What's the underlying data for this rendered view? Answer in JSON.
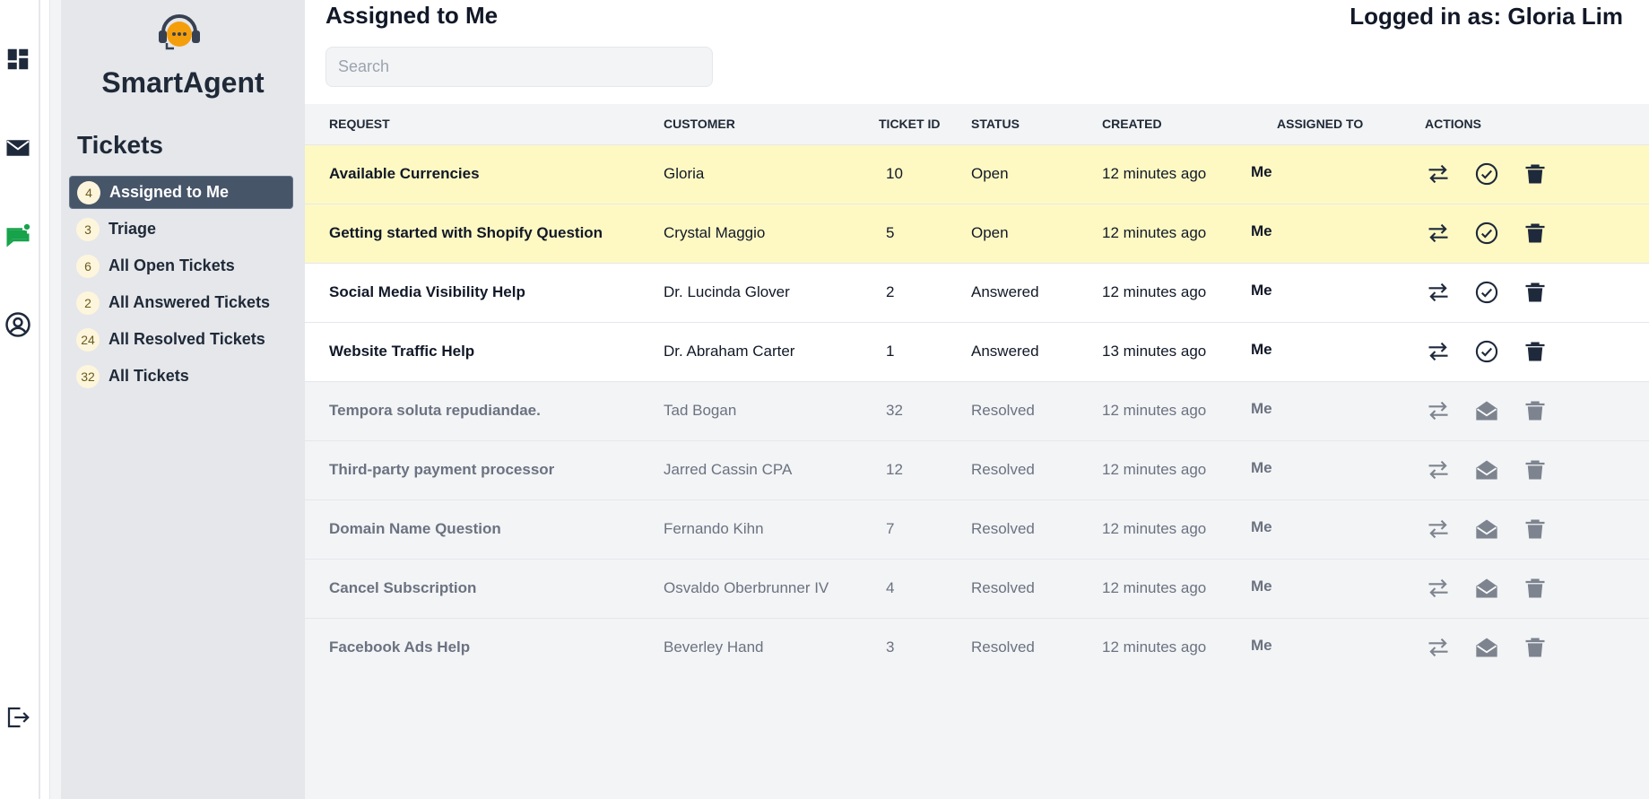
{
  "app": {
    "brand": "SmartAgent"
  },
  "rail": {
    "icons": [
      "dashboard-icon",
      "mail-icon",
      "chat-notification-icon",
      "user-circle-icon",
      "logout-icon"
    ],
    "accent": "#16a34a"
  },
  "sidebar": {
    "section_title": "Tickets",
    "items": [
      {
        "count": "4",
        "label": "Assigned to Me",
        "active": true
      },
      {
        "count": "3",
        "label": "Triage"
      },
      {
        "count": "6",
        "label": "All Open Tickets"
      },
      {
        "count": "2",
        "label": "All Answered Tickets"
      },
      {
        "count": "24",
        "label": "All Resolved Tickets"
      },
      {
        "count": "32",
        "label": "All Tickets"
      }
    ]
  },
  "header": {
    "title": "Assigned to Me",
    "logged_in": "Logged in as: Gloria Lim",
    "search_placeholder": "Search"
  },
  "table": {
    "columns": {
      "request": "Request",
      "customer": "Customer",
      "ticket_id": "Ticket ID",
      "status": "Status",
      "created": "Created",
      "assigned_to": "Assigned To",
      "actions": "Actions"
    },
    "rows": [
      {
        "request": "Available Currencies",
        "customer": "Gloria",
        "id": "10",
        "status": "Open",
        "created": "12 minutes ago",
        "assigned": "Me"
      },
      {
        "request": "Getting started with Shopify Question",
        "customer": "Crystal Maggio",
        "id": "5",
        "status": "Open",
        "created": "12 minutes ago",
        "assigned": "Me"
      },
      {
        "request": "Social Media Visibility Help",
        "customer": "Dr. Lucinda Glover",
        "id": "2",
        "status": "Answered",
        "created": "12 minutes ago",
        "assigned": "Me"
      },
      {
        "request": "Website Traffic Help",
        "customer": "Dr. Abraham Carter",
        "id": "1",
        "status": "Answered",
        "created": "13 minutes ago",
        "assigned": "Me"
      },
      {
        "request": "Tempora soluta repudiandae.",
        "customer": "Tad Bogan",
        "id": "32",
        "status": "Resolved",
        "created": "12 minutes ago",
        "assigned": "Me"
      },
      {
        "request": "Third-party payment processor",
        "customer": "Jarred Cassin CPA",
        "id": "12",
        "status": "Resolved",
        "created": "12 minutes ago",
        "assigned": "Me"
      },
      {
        "request": "Domain Name Question",
        "customer": "Fernando Kihn",
        "id": "7",
        "status": "Resolved",
        "created": "12 minutes ago",
        "assigned": "Me"
      },
      {
        "request": "Cancel Subscription",
        "customer": "Osvaldo Oberbrunner IV",
        "id": "4",
        "status": "Resolved",
        "created": "12 minutes ago",
        "assigned": "Me"
      },
      {
        "request": "Facebook Ads Help",
        "customer": "Beverley Hand",
        "id": "3",
        "status": "Resolved",
        "created": "12 minutes ago",
        "assigned": "Me"
      }
    ]
  },
  "colors": {
    "open_row": "#fef9c3",
    "active_nav": "#475569",
    "badge": "#fdf6dc"
  }
}
